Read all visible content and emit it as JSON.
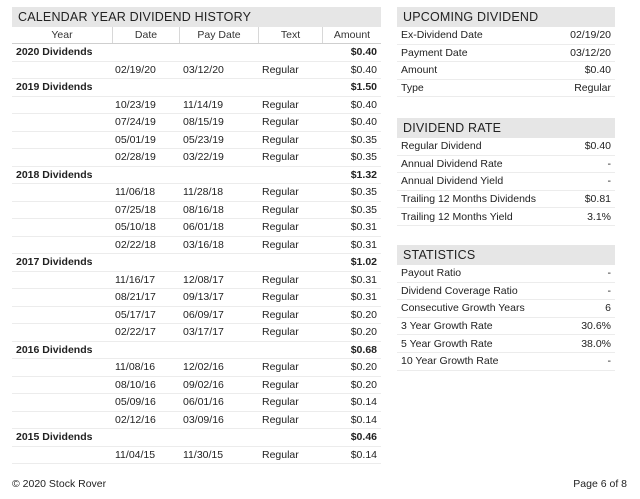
{
  "history": {
    "title": "CALENDAR YEAR DIVIDEND HISTORY",
    "headers": [
      "Year",
      "Date",
      "Pay Date",
      "Text",
      "Amount"
    ],
    "groups": [
      {
        "label": "2020 Dividends",
        "total": "$0.40",
        "rows": [
          {
            "date": "02/19/20",
            "pay": "03/12/20",
            "text": "Regular",
            "amount": "$0.40"
          }
        ]
      },
      {
        "label": "2019 Dividends",
        "total": "$1.50",
        "rows": [
          {
            "date": "10/23/19",
            "pay": "11/14/19",
            "text": "Regular",
            "amount": "$0.40"
          },
          {
            "date": "07/24/19",
            "pay": "08/15/19",
            "text": "Regular",
            "amount": "$0.40"
          },
          {
            "date": "05/01/19",
            "pay": "05/23/19",
            "text": "Regular",
            "amount": "$0.35"
          },
          {
            "date": "02/28/19",
            "pay": "03/22/19",
            "text": "Regular",
            "amount": "$0.35"
          }
        ]
      },
      {
        "label": "2018 Dividends",
        "total": "$1.32",
        "rows": [
          {
            "date": "11/06/18",
            "pay": "11/28/18",
            "text": "Regular",
            "amount": "$0.35"
          },
          {
            "date": "07/25/18",
            "pay": "08/16/18",
            "text": "Regular",
            "amount": "$0.35"
          },
          {
            "date": "05/10/18",
            "pay": "06/01/18",
            "text": "Regular",
            "amount": "$0.31"
          },
          {
            "date": "02/22/18",
            "pay": "03/16/18",
            "text": "Regular",
            "amount": "$0.31"
          }
        ]
      },
      {
        "label": "2017 Dividends",
        "total": "$1.02",
        "rows": [
          {
            "date": "11/16/17",
            "pay": "12/08/17",
            "text": "Regular",
            "amount": "$0.31"
          },
          {
            "date": "08/21/17",
            "pay": "09/13/17",
            "text": "Regular",
            "amount": "$0.31"
          },
          {
            "date": "05/17/17",
            "pay": "06/09/17",
            "text": "Regular",
            "amount": "$0.20"
          },
          {
            "date": "02/22/17",
            "pay": "03/17/17",
            "text": "Regular",
            "amount": "$0.20"
          }
        ]
      },
      {
        "label": "2016 Dividends",
        "total": "$0.68",
        "rows": [
          {
            "date": "11/08/16",
            "pay": "12/02/16",
            "text": "Regular",
            "amount": "$0.20"
          },
          {
            "date": "08/10/16",
            "pay": "09/02/16",
            "text": "Regular",
            "amount": "$0.20"
          },
          {
            "date": "05/09/16",
            "pay": "06/01/16",
            "text": "Regular",
            "amount": "$0.14"
          },
          {
            "date": "02/12/16",
            "pay": "03/09/16",
            "text": "Regular",
            "amount": "$0.14"
          }
        ]
      },
      {
        "label": "2015 Dividends",
        "total": "$0.46",
        "rows": [
          {
            "date": "11/04/15",
            "pay": "11/30/15",
            "text": "Regular",
            "amount": "$0.14"
          }
        ]
      }
    ]
  },
  "upcoming": {
    "title": "UPCOMING DIVIDEND",
    "items": [
      {
        "label": "Ex-Dividend Date",
        "value": "02/19/20"
      },
      {
        "label": "Payment Date",
        "value": "03/12/20"
      },
      {
        "label": "Amount",
        "value": "$0.40"
      },
      {
        "label": "Type",
        "value": "Regular"
      }
    ]
  },
  "rate": {
    "title": "DIVIDEND RATE",
    "items": [
      {
        "label": "Regular Dividend",
        "value": "$0.40"
      },
      {
        "label": "Annual Dividend Rate",
        "value": "-"
      },
      {
        "label": "Annual Dividend Yield",
        "value": "-"
      },
      {
        "label": "Trailing 12 Months Dividends",
        "value": "$0.81"
      },
      {
        "label": "Trailing 12 Months Yield",
        "value": "3.1%"
      }
    ]
  },
  "stats": {
    "title": "STATISTICS",
    "items": [
      {
        "label": "Payout Ratio",
        "value": "-"
      },
      {
        "label": "Dividend Coverage Ratio",
        "value": "-"
      },
      {
        "label": "Consecutive Growth Years",
        "value": "6"
      },
      {
        "label": "3 Year Growth Rate",
        "value": "30.6%"
      },
      {
        "label": "5 Year Growth Rate",
        "value": "38.0%"
      },
      {
        "label": "10 Year Growth Rate",
        "value": "-"
      }
    ]
  },
  "footer": {
    "copyright": "© 2020 Stock Rover",
    "page": "Page 6 of 8"
  }
}
